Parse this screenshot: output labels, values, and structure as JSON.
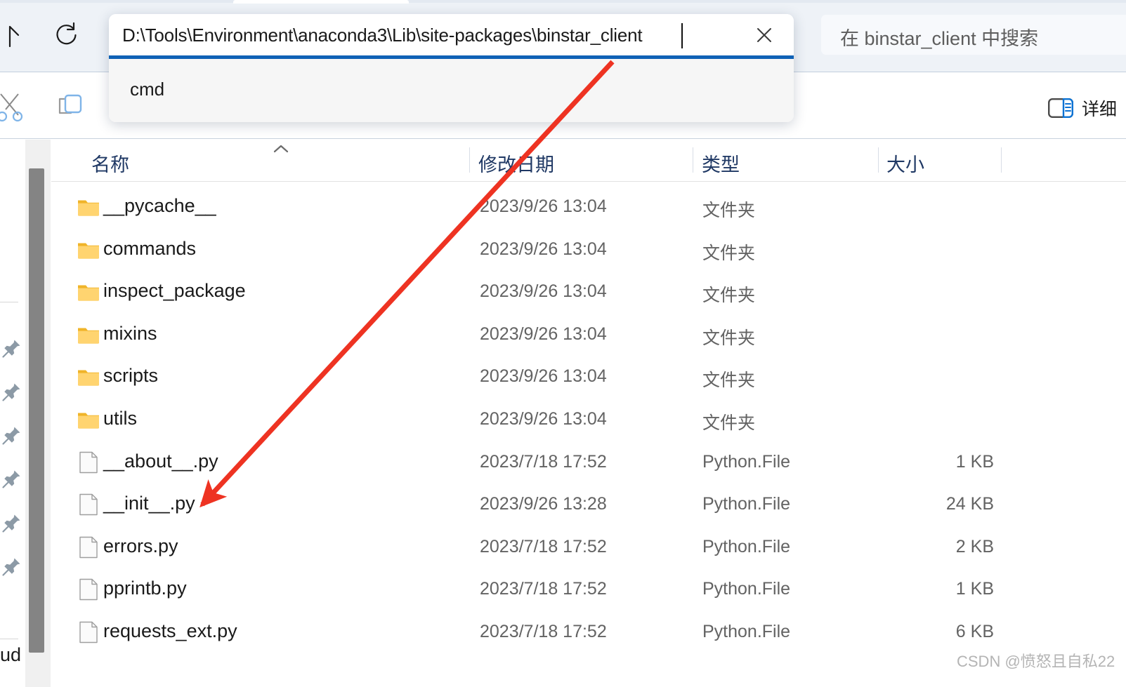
{
  "window": {
    "type": "file-explorer"
  },
  "toolbar": {
    "up_icon": "up-arrow-icon",
    "refresh_icon": "refresh-icon",
    "cut_icon": "cut-icon",
    "copy_icon": "copy-icon",
    "details_label": "详细",
    "details_icon": "details-pane-icon"
  },
  "address_bar": {
    "value": "D:\\Tools\\Environment\\anaconda3\\Lib\\site-packages\\binstar_client",
    "clear_icon": "close-icon",
    "suggestions": [
      {
        "label": "cmd"
      }
    ],
    "accent_color": "#0f62b6"
  },
  "search": {
    "placeholder": "在 binstar_client 中搜索",
    "icon": "search-icon"
  },
  "sidebar": {
    "pin_icon": "pin-icon",
    "pin_count": 6,
    "bottom_label": "ud"
  },
  "columns": {
    "name": "名称",
    "date_modified": "修改日期",
    "type": "类型",
    "size": "大小",
    "sort_indicator": "chevron-up-icon"
  },
  "rows": [
    {
      "icon": "folder-icon",
      "name": "__pycache__",
      "date": "2023/9/26 13:04",
      "type": "文件夹",
      "size": ""
    },
    {
      "icon": "folder-icon",
      "name": "commands",
      "date": "2023/9/26 13:04",
      "type": "文件夹",
      "size": ""
    },
    {
      "icon": "folder-icon",
      "name": "inspect_package",
      "date": "2023/9/26 13:04",
      "type": "文件夹",
      "size": ""
    },
    {
      "icon": "folder-icon",
      "name": "mixins",
      "date": "2023/9/26 13:04",
      "type": "文件夹",
      "size": ""
    },
    {
      "icon": "folder-icon",
      "name": "scripts",
      "date": "2023/9/26 13:04",
      "type": "文件夹",
      "size": ""
    },
    {
      "icon": "folder-icon",
      "name": "utils",
      "date": "2023/9/26 13:04",
      "type": "文件夹",
      "size": ""
    },
    {
      "icon": "file-icon",
      "name": "__about__.py",
      "date": "2023/7/18 17:52",
      "type": "Python.File",
      "size": "1 KB"
    },
    {
      "icon": "file-icon",
      "name": "__init__.py",
      "date": "2023/9/26 13:28",
      "type": "Python.File",
      "size": "24 KB"
    },
    {
      "icon": "file-icon",
      "name": "errors.py",
      "date": "2023/7/18 17:52",
      "type": "Python.File",
      "size": "2 KB"
    },
    {
      "icon": "file-icon",
      "name": "pprintb.py",
      "date": "2023/7/18 17:52",
      "type": "Python.File",
      "size": "1 KB"
    },
    {
      "icon": "file-icon",
      "name": "requests_ext.py",
      "date": "2023/7/18 17:52",
      "type": "Python.File",
      "size": "6 KB"
    }
  ],
  "annotation": {
    "arrow_color": "#ee3322",
    "target_row_name": "__init__.py"
  },
  "watermark": {
    "text": "CSDN @愤怒且自私22"
  }
}
